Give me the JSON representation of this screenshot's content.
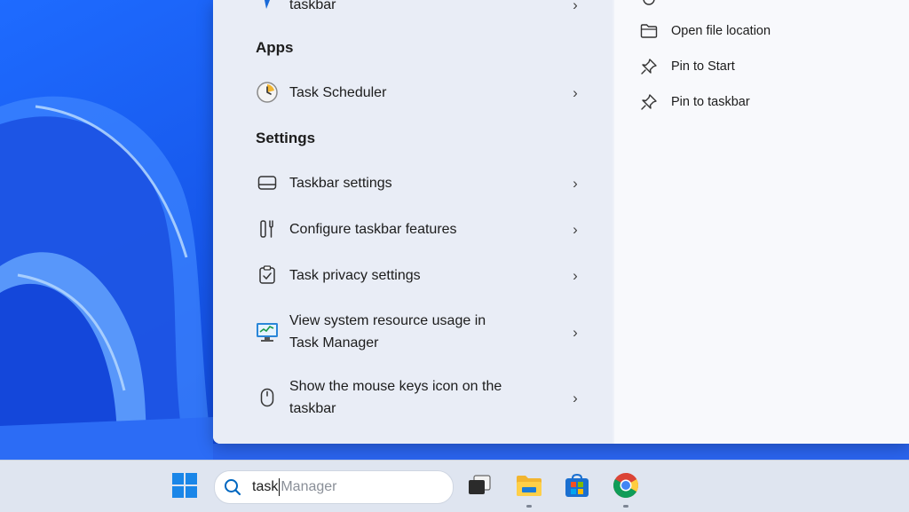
{
  "results": {
    "top_partial": {
      "label": "taskbar"
    },
    "sections": [
      {
        "title": "Apps"
      },
      {
        "title": "Settings"
      }
    ],
    "apps": [
      {
        "label": "Task Scheduler",
        "icon": "clock-icon"
      }
    ],
    "settings": [
      {
        "label": "Taskbar settings",
        "icon": "taskbar-icon"
      },
      {
        "label": "Configure taskbar features",
        "icon": "tools-icon"
      },
      {
        "label": "Task privacy settings",
        "icon": "clipboard-check-icon"
      },
      {
        "label_line1": "View system resource usage in",
        "label_line2": "Task Manager",
        "icon": "monitor-icon"
      },
      {
        "label_line1": "Show the mouse keys icon on the",
        "label_line2": "taskbar",
        "icon": "mouse-icon"
      }
    ],
    "chevron": "›"
  },
  "actions": [
    {
      "label": "Open file location",
      "icon": "folder-icon"
    },
    {
      "label": "Pin to Start",
      "icon": "pin-icon"
    },
    {
      "label": "Pin to taskbar",
      "icon": "pin-icon"
    }
  ],
  "taskbar": {
    "search_typed": "task",
    "search_suggestion": "Manager",
    "apps": [
      "start-icon",
      "task-view-icon",
      "file-explorer-icon",
      "microsoft-store-icon",
      "chrome-icon"
    ]
  },
  "colors": {
    "accent": "#0067c0",
    "wallpaper": "#1b58e6"
  }
}
